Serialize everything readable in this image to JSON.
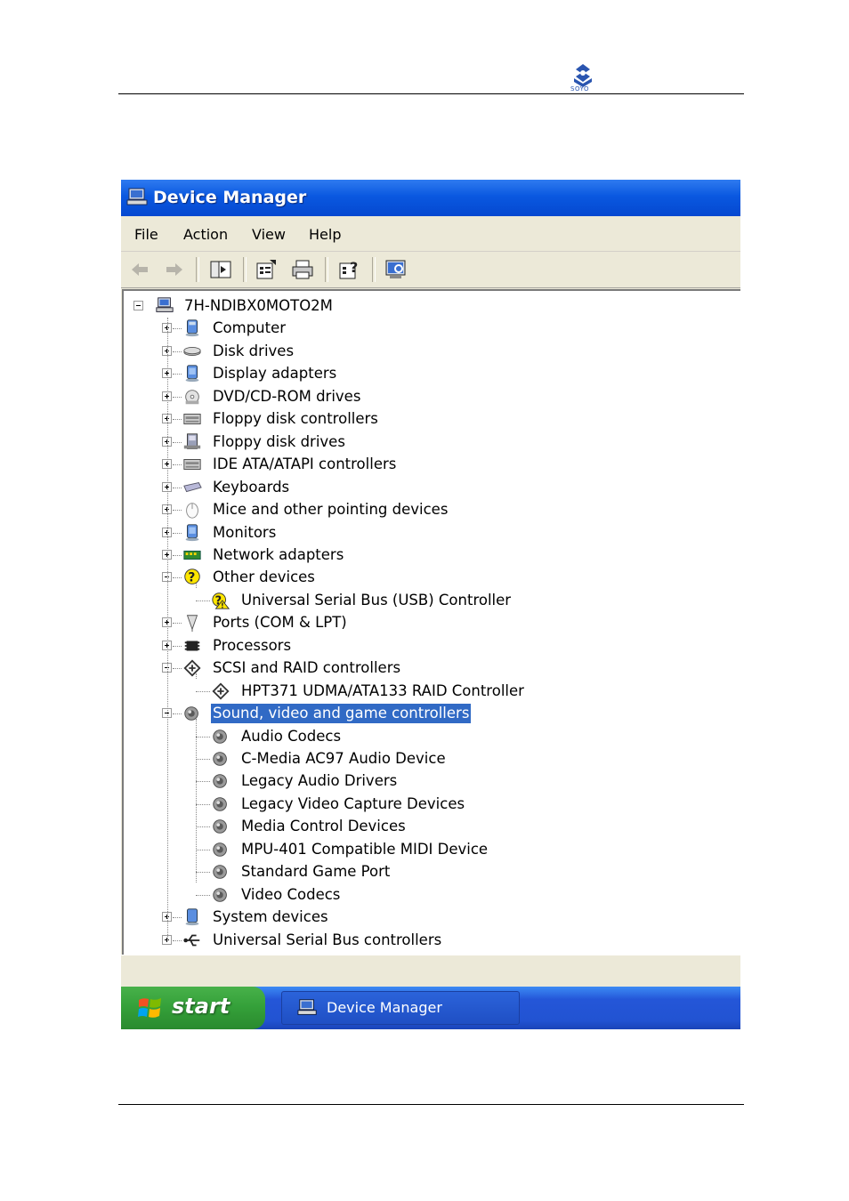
{
  "document": {
    "logo_text": "SOYO"
  },
  "window": {
    "title": "Device Manager"
  },
  "menu": [
    "File",
    "Action",
    "View",
    "Help"
  ],
  "toolbar": {
    "buttons": [
      "back-arrow-icon",
      "forward-arrow-icon",
      "show-hide-console-tree-icon",
      "properties-icon",
      "print-icon",
      "help-icon",
      "scan-hardware-icon"
    ]
  },
  "tree": {
    "root": "7H-NDIBX0MOTO2M",
    "items": [
      {
        "label": "Computer",
        "icon": "computer-icon",
        "expanded": false,
        "children": []
      },
      {
        "label": "Disk drives",
        "icon": "disk-drive-icon",
        "expanded": false,
        "children": []
      },
      {
        "label": "Display adapters",
        "icon": "display-adapter-icon",
        "expanded": false,
        "children": []
      },
      {
        "label": "DVD/CD-ROM drives",
        "icon": "cdrom-icon",
        "expanded": false,
        "children": []
      },
      {
        "label": "Floppy disk controllers",
        "icon": "floppy-controller-icon",
        "expanded": false,
        "children": []
      },
      {
        "label": "Floppy disk drives",
        "icon": "floppy-drive-icon",
        "expanded": false,
        "children": []
      },
      {
        "label": "IDE ATA/ATAPI controllers",
        "icon": "ide-controller-icon",
        "expanded": false,
        "children": []
      },
      {
        "label": "Keyboards",
        "icon": "keyboard-icon",
        "expanded": false,
        "children": []
      },
      {
        "label": "Mice and other pointing devices",
        "icon": "mouse-icon",
        "expanded": false,
        "children": []
      },
      {
        "label": "Monitors",
        "icon": "monitor-icon",
        "expanded": false,
        "children": []
      },
      {
        "label": "Network adapters",
        "icon": "network-adapter-icon",
        "expanded": false,
        "children": []
      },
      {
        "label": "Other devices",
        "icon": "unknown-device-icon",
        "expanded": true,
        "children": [
          {
            "label": "Universal Serial Bus (USB) Controller",
            "icon": "warning-device-icon"
          }
        ]
      },
      {
        "label": "Ports (COM & LPT)",
        "icon": "port-icon",
        "expanded": false,
        "children": []
      },
      {
        "label": "Processors",
        "icon": "processor-icon",
        "expanded": false,
        "children": []
      },
      {
        "label": "SCSI and RAID controllers",
        "icon": "scsi-icon",
        "expanded": true,
        "children": [
          {
            "label": "HPT371 UDMA/ATA133 RAID Controller",
            "icon": "scsi-icon"
          }
        ]
      },
      {
        "label": "Sound, video and game controllers",
        "icon": "speaker-icon",
        "expanded": true,
        "selected": true,
        "children": [
          {
            "label": "Audio Codecs",
            "icon": "speaker-icon"
          },
          {
            "label": "C-Media AC97 Audio Device",
            "icon": "speaker-icon"
          },
          {
            "label": "Legacy Audio Drivers",
            "icon": "speaker-icon"
          },
          {
            "label": "Legacy Video Capture Devices",
            "icon": "speaker-icon"
          },
          {
            "label": "Media Control Devices",
            "icon": "speaker-icon"
          },
          {
            "label": "MPU-401 Compatible MIDI Device",
            "icon": "speaker-icon"
          },
          {
            "label": "Standard Game Port",
            "icon": "speaker-icon"
          },
          {
            "label": "Video Codecs",
            "icon": "speaker-icon"
          }
        ]
      },
      {
        "label": "System devices",
        "icon": "system-device-icon",
        "expanded": false,
        "children": []
      },
      {
        "label": "Universal Serial Bus controllers",
        "icon": "usb-icon",
        "expanded": false,
        "children": []
      }
    ]
  },
  "taskbar": {
    "start_label": "start",
    "task_button_label": "Device Manager"
  },
  "colors": {
    "titlebar": "#0a58e0",
    "selection": "#316ac5",
    "start_green": "#35a13a",
    "taskbar_blue": "#2253d2"
  }
}
